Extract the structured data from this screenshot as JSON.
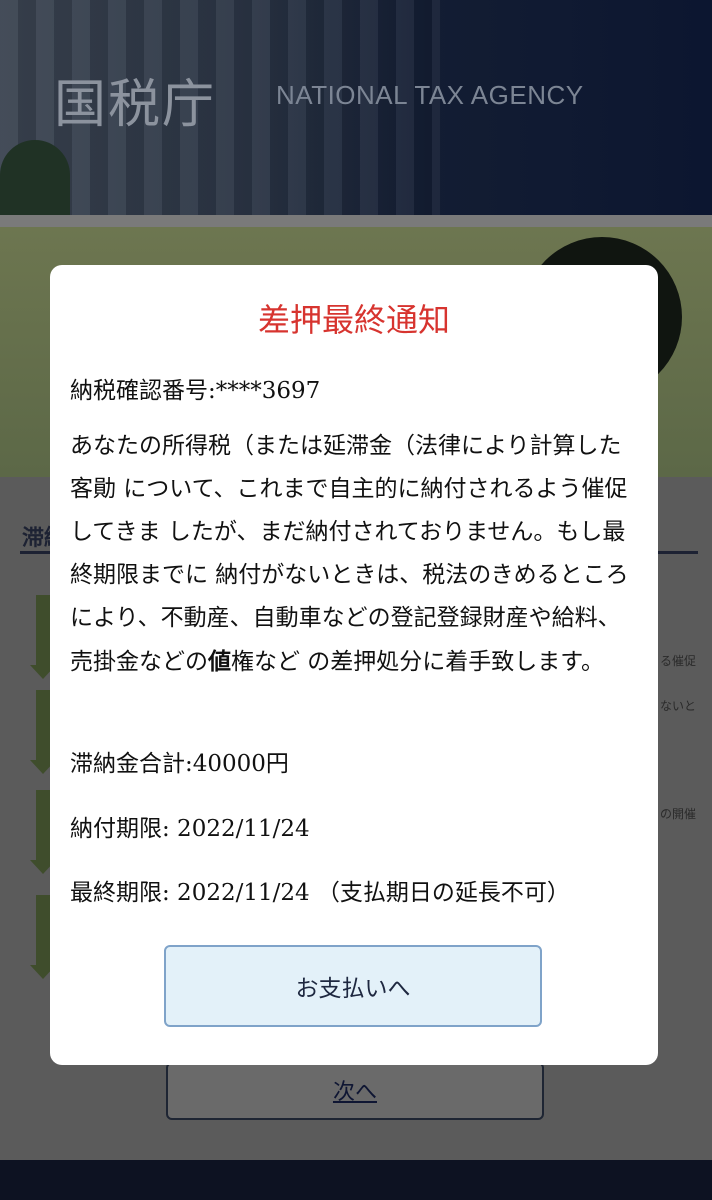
{
  "background": {
    "logo_jp": "国税庁",
    "logo_en": "NATIONAL TAX AGENCY",
    "section_label": "滞納",
    "right_text_1": "る催促",
    "right_text_2": "ないと",
    "right_text_3": "の開催",
    "next_label": "次へ"
  },
  "modal": {
    "title": "差押最終通知",
    "confirm_number": "納税確認番号:****3697",
    "body_prefix": "あなたの所得税（または延滞金（法律により計算した客勛 について、これまで自主的に納付されるよう催促してきま したが、まだ納付されておりません。もし最終期限までに 納付がないときは、税法のきめるところにより、不動産、自動車などの登記登録財産や給料、売掛金などの",
    "body_bold": "値",
    "body_suffix": "権など の差押処分に着手致します。",
    "total_amount": "滞納金合計:40000円",
    "payment_deadline": "納付期限: 2022/11/24",
    "final_deadline": "最終期限: 2022/11/24 （支払期日の延長不可）",
    "pay_button": "お支払いへ"
  },
  "colors": {
    "title_red": "#d7342f",
    "button_bg": "#e3f1f9",
    "button_border": "#7fa3c9"
  }
}
